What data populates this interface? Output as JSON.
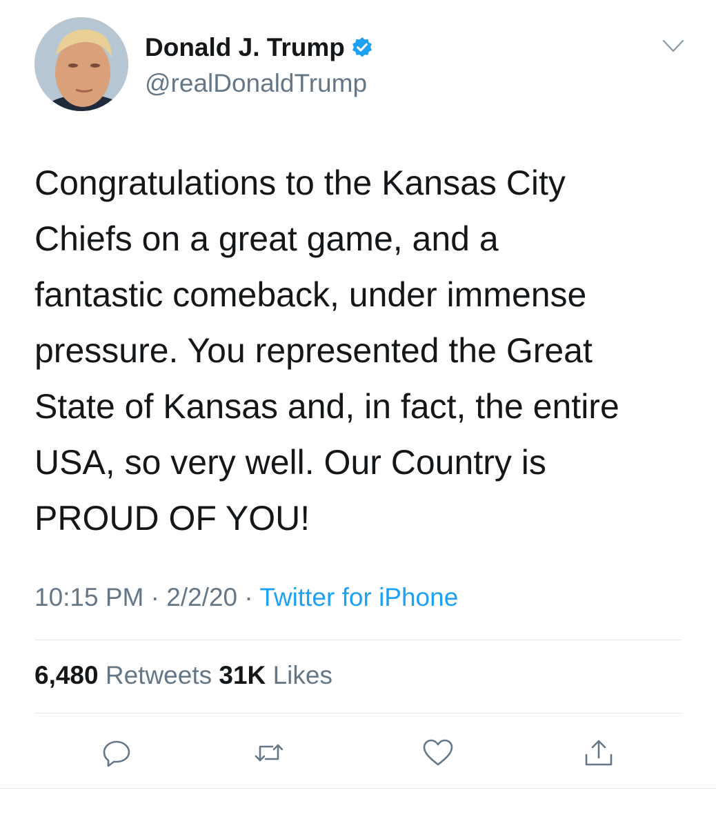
{
  "author": {
    "display_name": "Donald J. Trump",
    "handle": "@realDonaldTrump",
    "verified": true,
    "avatar_icon": "profile-photo"
  },
  "tweet": {
    "lines": [
      "Congratulations to the Kansas City",
      "Chiefs on a great game, and a",
      "fantastic comeback, under immense",
      "pressure. You represented the Great",
      "State of Kansas and, in fact, the entire",
      "USA, so very well. Our Country is",
      "PROUD OF YOU!"
    ]
  },
  "meta": {
    "time": "10:15 PM",
    "date": "2/2/20",
    "separator": "·",
    "source": "Twitter for iPhone"
  },
  "stats": {
    "retweets_count": "6,480",
    "retweets_label": "Retweets",
    "likes_count": "31K",
    "likes_label": "Likes"
  },
  "actions": {
    "reply_icon": "reply-icon",
    "retweet_icon": "retweet-icon",
    "like_icon": "heart-icon",
    "share_icon": "share-icon"
  },
  "colors": {
    "text": "#14171a",
    "secondary": "#657786",
    "accent": "#1da1f2",
    "divider": "#e1e8ed"
  }
}
